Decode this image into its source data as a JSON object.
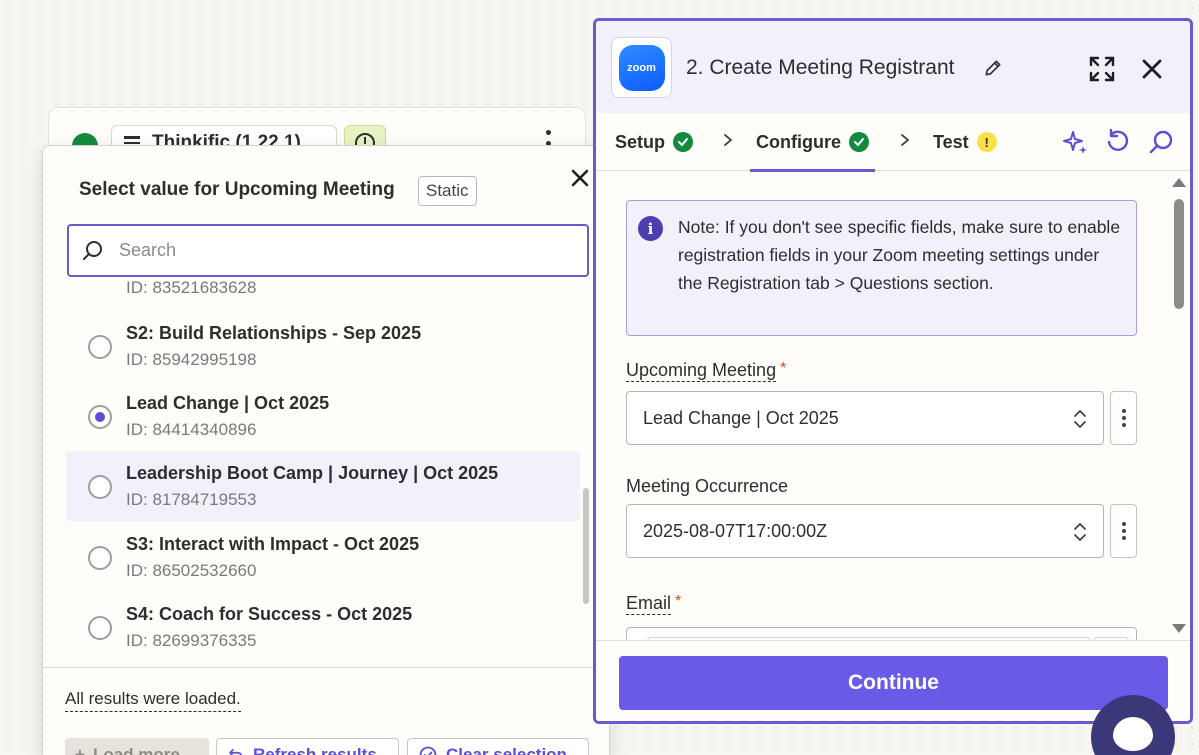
{
  "canvas_step": {
    "app_name": "Thinkific (1.22.1)"
  },
  "picker": {
    "title": "Select value for Upcoming Meeting",
    "badge": "Static",
    "search_placeholder": "Search",
    "partial_id": "ID: 83521683628",
    "options": [
      {
        "label": "S2: Build Relationships - Sep 2025",
        "id": "ID: 85942995198",
        "selected": false
      },
      {
        "label": "Lead Change | Oct 2025",
        "id": "ID: 84414340896",
        "selected": true
      },
      {
        "label": "Leadership Boot Camp | Journey | Oct 2025",
        "id": "ID: 81784719553",
        "selected": false,
        "hovered": true
      },
      {
        "label": "S3: Interact with Impact - Oct 2025",
        "id": "ID: 86502532660",
        "selected": false
      },
      {
        "label": "S4: Coach for Success - Oct 2025",
        "id": "ID: 82699376335",
        "selected": false
      }
    ],
    "status_text": "All results were loaded.",
    "load_more": "Load more",
    "refresh": "Refresh results",
    "clear": "Clear selection"
  },
  "panel": {
    "app_logo_text": "zoom",
    "title": "2. Create Meeting Registrant",
    "tabs": [
      {
        "label": "Setup",
        "status": "ok"
      },
      {
        "label": "Configure",
        "status": "ok",
        "active": true
      },
      {
        "label": "Test",
        "status": "warning"
      }
    ],
    "warning_glyph": "!",
    "note_glyph": "i",
    "note": "Note: If you don't see specific fields, make sure to enable registration fields in your Zoom meeting settings under the Registration tab > Questions section.",
    "fields": {
      "upcoming_meeting": {
        "label": "Upcoming Meeting",
        "required_mark": "*",
        "value": "Lead Change | Oct 2025"
      },
      "meeting_occurrence": {
        "label": "Meeting Occurrence",
        "value": "2025-08-07T17:00:00Z"
      },
      "email": {
        "label": "Email",
        "required_mark": "*"
      }
    },
    "continue_label": "Continue"
  },
  "colors": {
    "accent": "#6a5acd",
    "success": "#138a3d",
    "warning": "#fde047",
    "required": "#d3461f",
    "primary_button": "#695be8"
  }
}
